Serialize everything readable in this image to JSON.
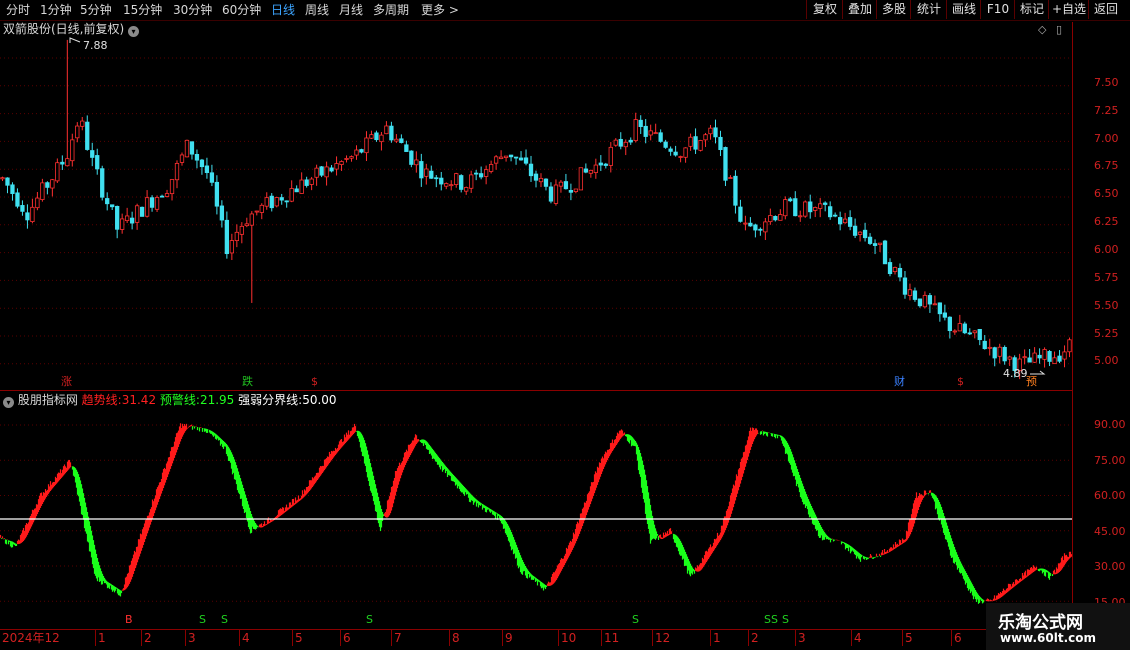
{
  "toolbar": {
    "periods": [
      "分时",
      "1分钟",
      "5分钟",
      "15分钟",
      "30分钟",
      "60分钟",
      "日线",
      "周线",
      "月线",
      "多周期",
      "更多"
    ],
    "more_arrow": ">",
    "active_period": "日线",
    "buttons": [
      "复权",
      "叠加",
      "多股",
      "统计",
      "画线",
      "F10",
      "标记",
      "+自选",
      "返回"
    ]
  },
  "main_chart": {
    "title": "双箭股份(日线,前复权)",
    "title_icon": "chevron-down-circle-icon",
    "high_label": "7.88",
    "low_label": "4.89",
    "y_ticks": [
      "7.50",
      "7.25",
      "7.00",
      "6.75",
      "6.50",
      "6.25",
      "6.00",
      "5.75",
      "5.50",
      "5.25",
      "5.00"
    ],
    "event_tags": [
      {
        "text": "涨",
        "color": "#d02020"
      },
      {
        "text": "跌",
        "color": "#20c020"
      },
      {
        "text": "$",
        "color": "#d02020"
      },
      {
        "text": "财",
        "color": "#3a80ff"
      },
      {
        "text": "$",
        "color": "#d02020"
      },
      {
        "text": "预",
        "color": "#ff8020"
      }
    ]
  },
  "indicator": {
    "name": "股朋指标网",
    "trend_label": "趋势线:",
    "trend_value": "31.42",
    "warn_label": "预警线:",
    "warn_value": "21.95",
    "bound_label": "强弱分界线:",
    "bound_value": "50.00",
    "y_ticks": [
      "90.00",
      "75.00",
      "60.00",
      "45.00",
      "30.00",
      "15.00"
    ],
    "signals": [
      "B",
      "S",
      "S",
      "S",
      "S",
      "SS",
      "S"
    ],
    "colors": {
      "trend": "#ff2020",
      "warn": "#20ff20",
      "bound": "#ffffff"
    }
  },
  "date_axis": [
    "2024年12",
    "1",
    "2",
    "3",
    "4",
    "5",
    "6",
    "7",
    "8",
    "9",
    "10",
    "11",
    "12",
    "1",
    "2",
    "3",
    "4",
    "5",
    "6"
  ],
  "watermark": {
    "line1": "乐淘公式网",
    "line2": "www.60lt.com"
  }
}
